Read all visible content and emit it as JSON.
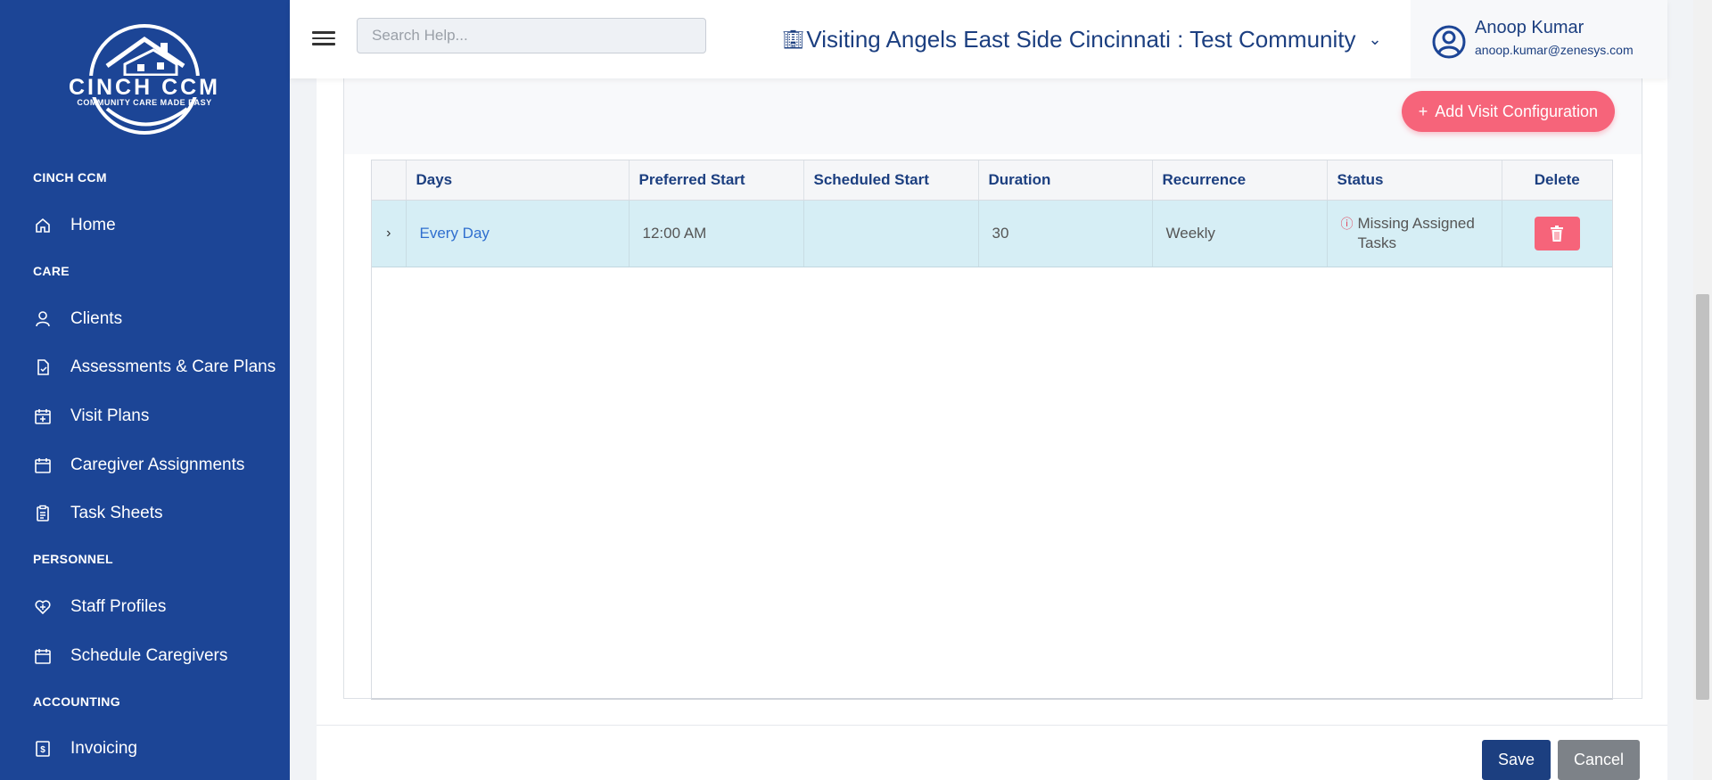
{
  "sidebar": {
    "logo": {
      "line1": "CINCH CCM",
      "line2": "COMMUNITY CARE MADE EASY"
    },
    "sections": {
      "cinch": "CINCH CCM",
      "care": "CARE",
      "personnel": "PERSONNEL",
      "accounting": "ACCOUNTING"
    },
    "items": [
      {
        "label": "Home",
        "icon": "home-icon"
      },
      {
        "label": "Clients",
        "icon": "user-icon"
      },
      {
        "label": "Assessments & Care Plans",
        "icon": "document-icon"
      },
      {
        "label": "Visit Plans",
        "icon": "calendar-plus-icon"
      },
      {
        "label": "Caregiver Assignments",
        "icon": "calendar-icon"
      },
      {
        "label": "Task Sheets",
        "icon": "clipboard-icon"
      },
      {
        "label": "Staff Profiles",
        "icon": "heart-shield-icon"
      },
      {
        "label": "Schedule Caregivers",
        "icon": "calendar-icon"
      },
      {
        "label": "Invoicing",
        "icon": "invoice-icon"
      }
    ]
  },
  "header": {
    "search_placeholder": "Search Help...",
    "organization": "Visiting Angels East Side Cincinnati : Test Community",
    "user": {
      "name": "Anoop Kumar",
      "email": "anoop.kumar@zenesys.com"
    }
  },
  "main": {
    "add_button": "Add Visit Configuration",
    "table": {
      "headers": [
        "Days",
        "Preferred Start",
        "Scheduled Start",
        "Duration",
        "Recurrence",
        "Status",
        "Delete"
      ],
      "rows": [
        {
          "expander": "›",
          "days": "Every Day",
          "preferred_start": "12:00 AM",
          "scheduled_start": "",
          "duration": "30",
          "recurrence": "Weekly",
          "status": "Missing Assigned Tasks"
        }
      ]
    },
    "save": "Save",
    "cancel": "Cancel"
  },
  "colors": {
    "sidebar": "#1c4596",
    "accent_pink": "#f6647a",
    "navy": "#1c3f80",
    "row_highlight": "#d6eef5",
    "link": "#2f6fcf"
  }
}
